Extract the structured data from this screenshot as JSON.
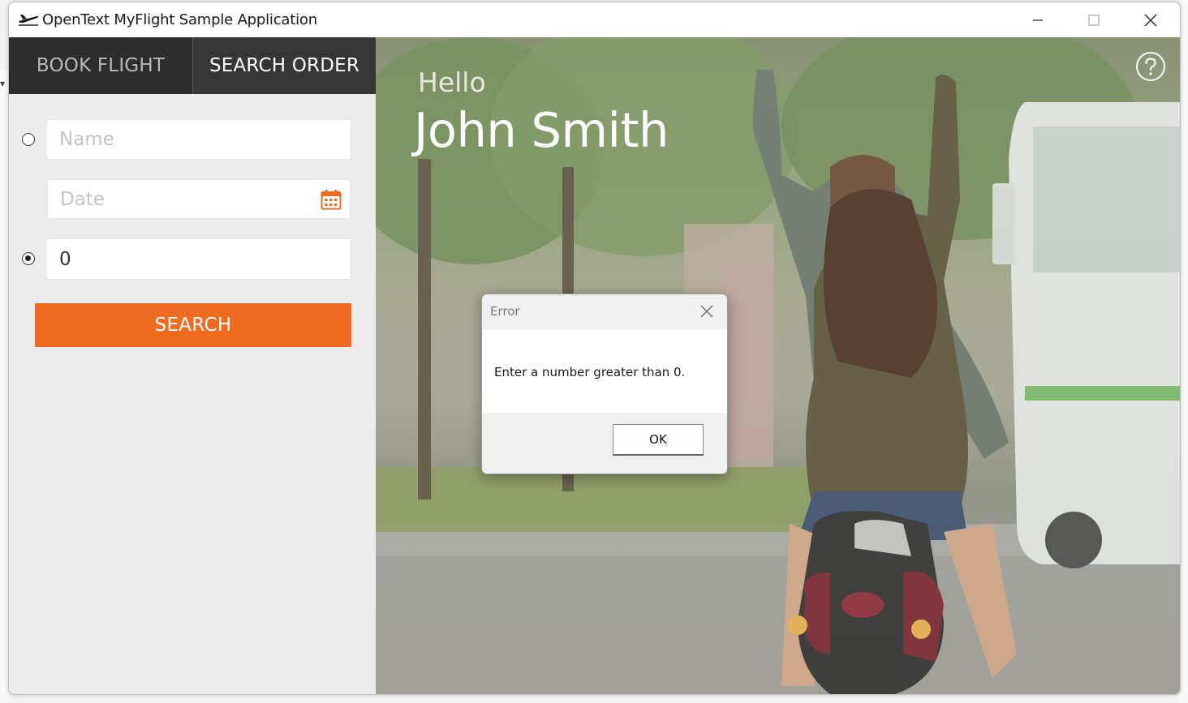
{
  "window": {
    "title": "OpenText MyFlight Sample Application",
    "minimize_label": "minimize",
    "maximize_label": "maximize",
    "close_label": "close"
  },
  "tabs": [
    {
      "label": "BOOK FLIGHT",
      "active": false
    },
    {
      "label": "SEARCH ORDER",
      "active": true
    }
  ],
  "search_form": {
    "mode": "order-number",
    "name_placeholder": "Name",
    "date_placeholder": "Date",
    "order_number_value": "0",
    "search_button": "SEARCH"
  },
  "hero": {
    "greeting": "Hello",
    "user_name": "John Smith"
  },
  "error_dialog": {
    "title": "Error",
    "message": "Enter a number greater than 0.",
    "ok_button": "OK"
  },
  "colors": {
    "accent": "#f06b22",
    "tab_bar": "#2d2d2d",
    "left_panel": "#ececec"
  }
}
